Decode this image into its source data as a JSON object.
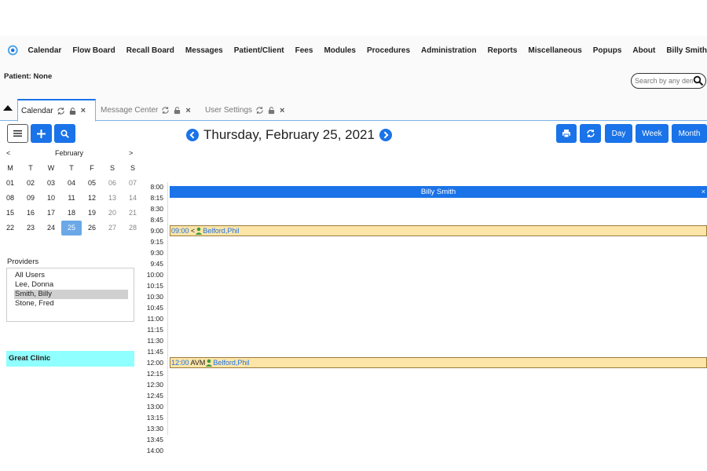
{
  "nav": {
    "items": [
      "Calendar",
      "Flow Board",
      "Recall Board",
      "Messages",
      "Patient/Client",
      "Fees",
      "Modules",
      "Procedures",
      "Administration",
      "Reports",
      "Miscellaneous",
      "Popups",
      "About",
      "Billy Smith"
    ]
  },
  "patient": {
    "label": "Patient: None"
  },
  "search": {
    "placeholder": "Search by any demographics"
  },
  "tabs": [
    {
      "label": "Calendar",
      "active": true
    },
    {
      "label": "Message Center",
      "active": false
    },
    {
      "label": "User Settings",
      "active": false
    }
  ],
  "calendar": {
    "date_title": "Thursday, February 25, 2021",
    "view_buttons": {
      "day": "Day",
      "week": "Week",
      "month": "Month"
    }
  },
  "mini_calendar": {
    "prev": "<",
    "next": ">",
    "month": "February",
    "weekdays": [
      "M",
      "T",
      "W",
      "T",
      "F",
      "S",
      "S"
    ],
    "weeks": [
      [
        "01",
        "02",
        "03",
        "04",
        "05",
        "06",
        "07"
      ],
      [
        "08",
        "09",
        "10",
        "11",
        "12",
        "13",
        "14"
      ],
      [
        "15",
        "16",
        "17",
        "18",
        "19",
        "20",
        "21"
      ],
      [
        "22",
        "23",
        "24",
        "25",
        "26",
        "27",
        "28"
      ]
    ],
    "selected": "25"
  },
  "providers": {
    "label": "Providers",
    "items": [
      "All Users",
      "Lee, Donna",
      "Smith, Billy",
      "Stone, Fred"
    ],
    "selected": "Smith, Billy"
  },
  "facility": {
    "name": "Great Clinic"
  },
  "day_view": {
    "provider": "Billy Smith",
    "close": "×",
    "times": [
      "8:00",
      "8:15",
      "8:30",
      "8:45",
      "9:00",
      "9:15",
      "9:30",
      "9:45",
      "10:00",
      "10:15",
      "10:30",
      "10:45",
      "11:00",
      "11:15",
      "11:30",
      "11:45",
      "12:00",
      "12:15",
      "12:30",
      "12:45",
      "13:00",
      "13:15",
      "13:30",
      "13:45",
      "14:00"
    ],
    "appointments": [
      {
        "time": "09:00",
        "category": "<",
        "patient": "Belford,Phil"
      },
      {
        "time": "12:00",
        "category": "AVM",
        "patient": "Belford,Phil"
      }
    ]
  },
  "colors": {
    "accent": "#1a73e8",
    "appointment": "#fde5a8",
    "facility": "#90ffff"
  }
}
